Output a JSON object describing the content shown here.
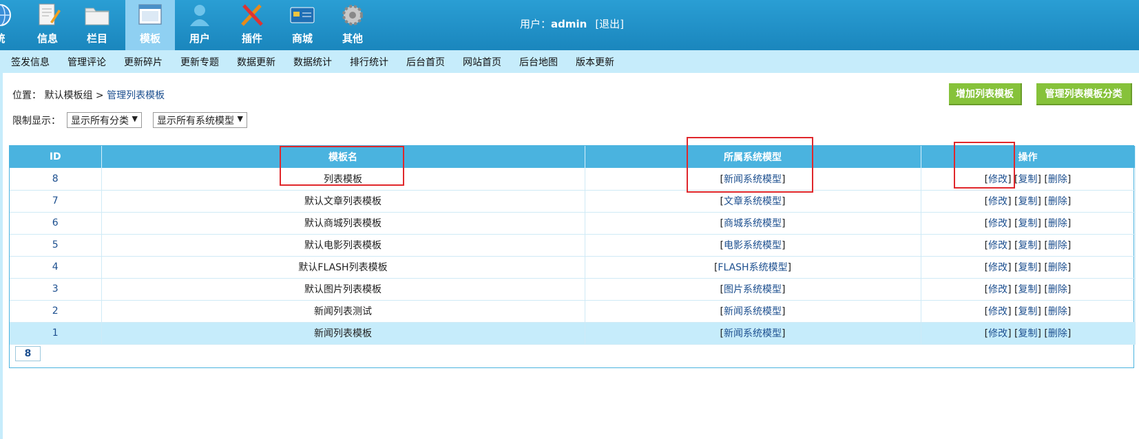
{
  "nav": {
    "items": [
      {
        "label": "统",
        "icon": "globe-icon"
      },
      {
        "label": "信息",
        "icon": "document-edit-icon"
      },
      {
        "label": "栏目",
        "icon": "folder-icon"
      },
      {
        "label": "模板",
        "icon": "window-template-icon",
        "active": true
      },
      {
        "label": "用户",
        "icon": "user-icon"
      },
      {
        "label": "插件",
        "icon": "tools-icon"
      },
      {
        "label": "商城",
        "icon": "card-icon"
      },
      {
        "label": "其他",
        "icon": "gear-icon"
      }
    ],
    "user_prefix": "用户：",
    "username": "admin",
    "logout": "[退出]"
  },
  "submenu": [
    "签发信息",
    "管理评论",
    "更新碎片",
    "更新专题",
    "数据更新",
    "数据统计",
    "排行统计",
    "后台首页",
    "网站首页",
    "后台地图",
    "版本更新"
  ],
  "breadcrumb": {
    "prefix": "位置：",
    "group": "默认模板组",
    "sep": ">",
    "current": "管理列表模板"
  },
  "filter": {
    "label": "限制显示：",
    "category": "显示所有分类",
    "model": "显示所有系统模型"
  },
  "buttons": {
    "add": "增加列表模板",
    "manage_categories": "管理列表模板分类"
  },
  "table": {
    "headers": [
      "ID",
      "模板名",
      "所属系统模型",
      "操作"
    ],
    "rows": [
      {
        "id": "8",
        "name": "列表模板",
        "model": "新闻系统模型"
      },
      {
        "id": "7",
        "name": "默认文章列表模板",
        "model": "文章系统模型"
      },
      {
        "id": "6",
        "name": "默认商城列表模板",
        "model": "商城系统模型"
      },
      {
        "id": "5",
        "name": "默认电影列表模板",
        "model": "电影系统模型"
      },
      {
        "id": "4",
        "name": "默认FLASH列表模板",
        "model": "FLASH系统模型"
      },
      {
        "id": "3",
        "name": "默认图片列表模板",
        "model": "图片系统模型"
      },
      {
        "id": "2",
        "name": "新闻列表测试",
        "model": "新闻系统模型"
      },
      {
        "id": "1",
        "name": "新闻列表模板",
        "model": "新闻系统模型",
        "highlight": true
      }
    ],
    "actions": {
      "edit": "修改",
      "copy": "复制",
      "delete": "删除"
    },
    "total": "8"
  },
  "colors": {
    "header": "#1f92c8",
    "submenu": "#c6ecfb",
    "table_header": "#4ab3df",
    "green_button": "#86c23a",
    "annotation": "#e0272b"
  }
}
